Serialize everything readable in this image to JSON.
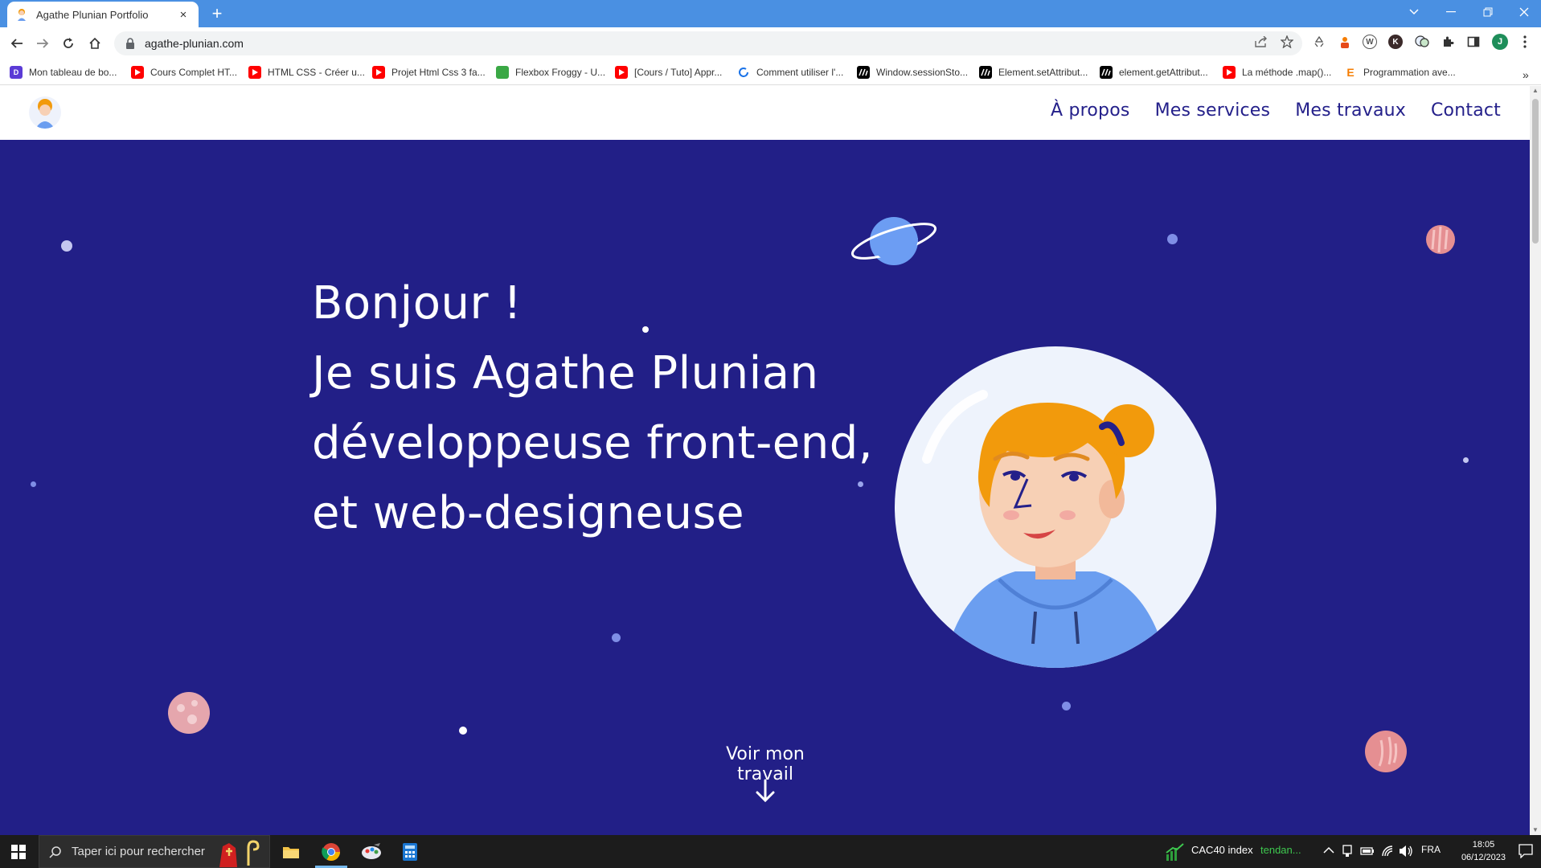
{
  "browser": {
    "tab_title": "Agathe Plunian Portfolio",
    "tab_close": "×",
    "new_tab": "+",
    "url": "agathe-plunian.com"
  },
  "bookmarks": [
    {
      "label": "Mon tableau de bo...",
      "icon": "dailydev-icon",
      "color": "#5b3bd6"
    },
    {
      "label": "Cours Complet HT...",
      "icon": "youtube-icon",
      "color": "#ff0000"
    },
    {
      "label": "HTML CSS - Créer u...",
      "icon": "youtube-icon",
      "color": "#ff0000"
    },
    {
      "label": "Projet Html Css 3 fa...",
      "icon": "youtube-icon",
      "color": "#ff0000"
    },
    {
      "label": "Flexbox Froggy - U...",
      "icon": "frog-icon",
      "color": "#3aa845"
    },
    {
      "label": "[Cours / Tuto] Appr...",
      "icon": "youtube-icon",
      "color": "#ff0000"
    },
    {
      "label": "Comment utiliser l'...",
      "icon": "sync-icon",
      "color": "#1a73e8"
    },
    {
      "label": "Window.sessionSto...",
      "icon": "mdn-icon",
      "color": "#000000"
    },
    {
      "label": "Element.setAttribut...",
      "icon": "mdn-icon",
      "color": "#000000"
    },
    {
      "label": "element.getAttribut...",
      "icon": "mdn-icon",
      "color": "#000000"
    },
    {
      "label": "La méthode .map()...",
      "icon": "youtube-icon",
      "color": "#ff0000"
    },
    {
      "label": "Programmation ave...",
      "icon": "e-icon",
      "color": "#f57c00"
    }
  ],
  "site": {
    "nav": [
      "À propos",
      "Mes services",
      "Mes travaux",
      "Contact"
    ],
    "hero_lines": [
      "Bonjour !",
      "Je suis Agathe Plunian",
      "développeuse front-end,",
      "et web-designeuse"
    ],
    "cta": "Voir mon travail"
  },
  "colors": {
    "hero_bg": "#221f87",
    "nav_text": "#24208a",
    "hair": "#f29a0c",
    "hoodie": "#6b9ef0"
  },
  "taskbar": {
    "search_placeholder": "Taper ici pour rechercher",
    "widget_label": "CAC40 index",
    "widget_status": "tendan...",
    "language": "FRA",
    "time": "18:05",
    "date": "06/12/2023"
  }
}
